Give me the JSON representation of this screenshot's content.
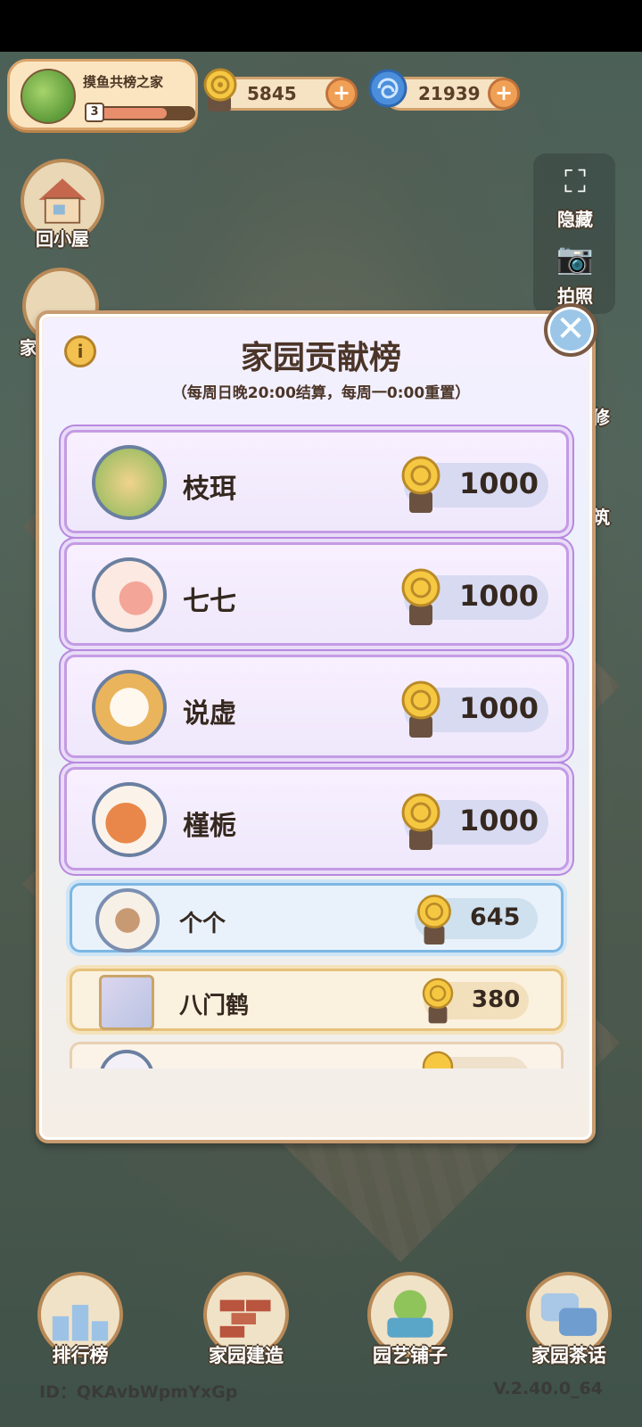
{
  "hud": {
    "home_name": "摸鱼共榜之家",
    "level": "3",
    "level_progress": 0.72,
    "snail_currency": "5845",
    "spiral_currency": "21939",
    "plus": "+"
  },
  "left_buttons": {
    "back_home_label": "回小屋",
    "home_label_partial": "家"
  },
  "right_buttons": {
    "hide_label": "隐藏",
    "photo_label": "拍照",
    "repair_partial": "修",
    "build_partial": "筑"
  },
  "dialog": {
    "title": "家园贡献榜",
    "subtitle": "（每周日晚20:00结算，每周一0:00重置）",
    "info_glyph": "i",
    "close_glyph": "✕",
    "entries": [
      {
        "name": "枝珥",
        "score": "1000",
        "tier": "purple"
      },
      {
        "name": "七七",
        "score": "1000",
        "tier": "purple"
      },
      {
        "name": "说虚",
        "score": "1000",
        "tier": "purple"
      },
      {
        "name": "槿栀",
        "score": "1000",
        "tier": "purple"
      },
      {
        "name": "个个",
        "score": "645",
        "tier": "blue"
      },
      {
        "name": "八门鹤",
        "score": "380",
        "tier": "gold"
      }
    ]
  },
  "bottom_nav": [
    {
      "label": "排行榜"
    },
    {
      "label": "家园建造"
    },
    {
      "label": "园艺铺子"
    },
    {
      "label": "家园茶话"
    }
  ],
  "footer": {
    "id": "ID：QKAvbWpmYxGp",
    "version": "V.2.40.0_64"
  },
  "colors": {
    "purple_frame": "#c49be4",
    "blue_frame": "#7db7e3",
    "gold_frame": "#e6c27a",
    "title_text": "#4b3528"
  }
}
